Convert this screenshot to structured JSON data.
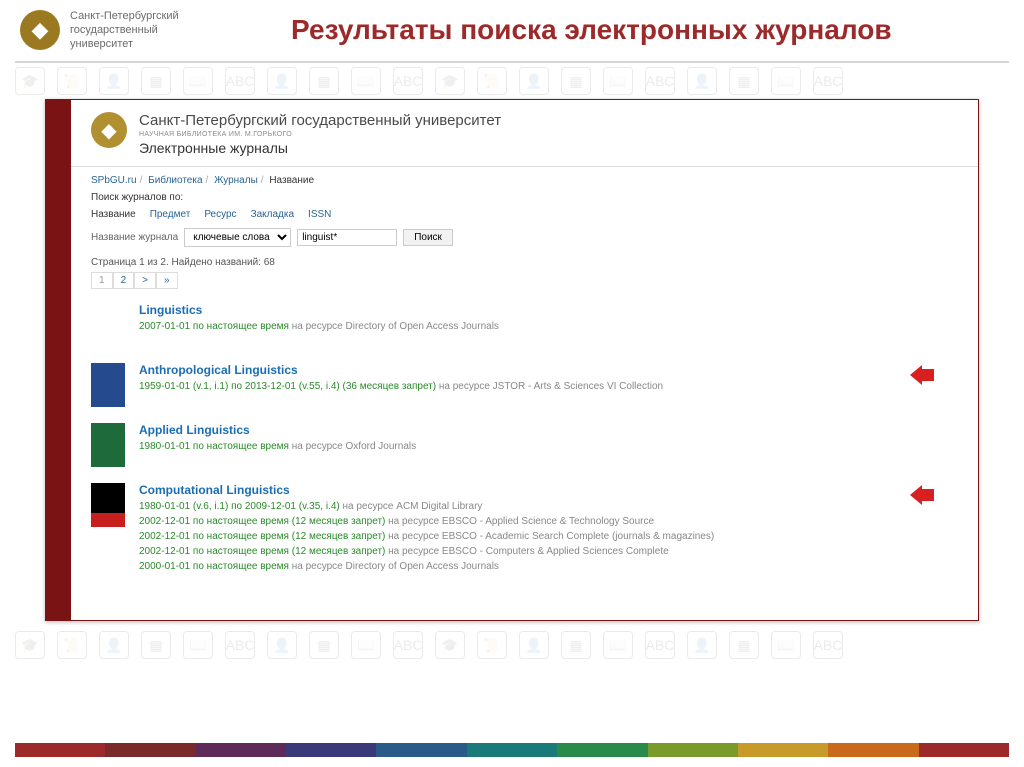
{
  "slide": {
    "uni_l1": "Санкт-Петербургский",
    "uni_l2": "государственный",
    "uni_l3": "университет",
    "title": "Результаты поиска электронных журналов"
  },
  "site": {
    "name": "Санкт-Петербургский государственный университет",
    "library": "НАУЧНАЯ БИБЛИОТЕКА ИМ. М.ГОРЬКОГО",
    "section": "Электронные журналы"
  },
  "breadcrumb": [
    "SPbGU.ru",
    "Библиотека",
    "Журналы",
    "Название"
  ],
  "search": {
    "heading": "Поиск журналов по:",
    "tabs": [
      "Название",
      "Предмет",
      "Ресурс",
      "Закладка",
      "ISSN"
    ],
    "active_tab": 0,
    "field_label": "Название журнала",
    "mode_value": "ключевые слова",
    "query": "linguist*",
    "button": "Поиск"
  },
  "pagination": {
    "info": "Страница 1 из 2. Найдено названий: 68",
    "items": [
      "1",
      "2",
      ">",
      "»"
    ]
  },
  "results": [
    {
      "title": "Linguistics",
      "thumb_color": "",
      "lines": [
        {
          "link": "2007-01-01 по настоящее время",
          "rest": " на ресурсе Directory of Open Access Journals"
        }
      ],
      "arrow": false
    },
    {
      "title": "Anthropological Linguistics",
      "thumb_color": "#254a8e",
      "lines": [
        {
          "link": "1959-01-01 (v.1, i.1) по 2013-12-01 (v.55, i.4) (36 месяцев запрет)",
          "rest": " на ресурсе JSTOR - Arts & Sciences VI Collection"
        }
      ],
      "arrow": true
    },
    {
      "title": "Applied Linguistics",
      "thumb_color": "#1e6a3a",
      "lines": [
        {
          "link": "1980-01-01 по настоящее время",
          "rest": " на ресурсе Oxford Journals"
        }
      ],
      "arrow": false
    },
    {
      "title": "Computational Linguistics",
      "thumb_color": "#000000",
      "thumb_accent": "#c81e1e",
      "lines": [
        {
          "link": "1980-01-01 (v.6, i.1) по 2009-12-01 (v.35, i.4)",
          "rest": " на ресурсе ACM Digital Library"
        },
        {
          "link": "2002-12-01 по настоящее время (12 месяцев запрет)",
          "rest": " на ресурсе EBSCO - Applied Science & Technology Source"
        },
        {
          "link": "2002-12-01 по настоящее время (12 месяцев запрет)",
          "rest": " на ресурсе EBSCO - Academic Search Complete (journals & magazines)"
        },
        {
          "link": "2002-12-01 по настоящее время (12 месяцев запрет)",
          "rest": " на ресурсе EBSCO - Computers & Applied Sciences Complete"
        },
        {
          "link": "2000-01-01 по настоящее время",
          "rest": " на ресурсе Directory of Open Access Journals"
        }
      ],
      "arrow": true
    }
  ],
  "footer_colors": [
    "#9c2a2a",
    "#7a2a2a",
    "#5d2a5a",
    "#3a3a7a",
    "#2a5a8a",
    "#1a7a7a",
    "#2a8a4a",
    "#7a9a2a",
    "#c89a2a",
    "#c86a1a",
    "#9c2a2a"
  ]
}
